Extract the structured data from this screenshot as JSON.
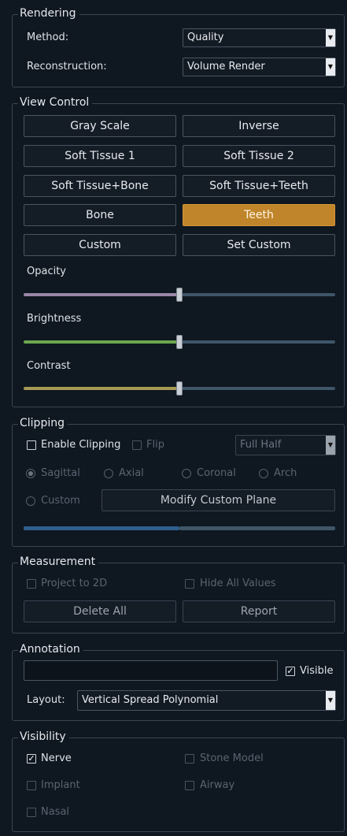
{
  "rendering": {
    "title": "Rendering",
    "method_label": "Method:",
    "method_value": "Quality",
    "reconstruction_label": "Reconstruction:",
    "reconstruction_value": "Volume Render"
  },
  "view_control": {
    "title": "View Control",
    "buttons": [
      "Gray Scale",
      "Inverse",
      "Soft Tissue 1",
      "Soft Tissue 2",
      "Soft Tissue+Bone",
      "Soft Tissue+Teeth",
      "Bone",
      "Teeth",
      "Custom",
      "Set Custom"
    ],
    "active_button": "Teeth",
    "opacity": {
      "label": "Opacity",
      "value": 0.5
    },
    "brightness": {
      "label": "Brightness",
      "value": 0.5
    },
    "contrast": {
      "label": "Contrast",
      "value": 0.5
    },
    "colors": {
      "opacity": "#9a86a8",
      "brightness": "#6aa84f",
      "contrast": "#a89a55",
      "rest": "#3e5668",
      "active": "#c0852a"
    }
  },
  "clipping": {
    "title": "Clipping",
    "enable_label": "Enable Clipping",
    "enable_checked": false,
    "flip_label": "Flip",
    "mode_value": "Full Half",
    "radios": [
      "Sagittal",
      "Axial",
      "Coronal",
      "Arch",
      "Custom"
    ],
    "selected_radio": "Sagittal",
    "modify_label": "Modify Custom Plane",
    "slider_value": 0.5
  },
  "measurement": {
    "title": "Measurement",
    "project_label": "Project to 2D",
    "hide_label": "Hide All Values",
    "delete_label": "Delete All",
    "report_label": "Report"
  },
  "annotation": {
    "title": "Annotation",
    "text_value": "",
    "visible_label": "Visible",
    "visible_checked": true,
    "layout_label": "Layout:",
    "layout_value": "Vertical Spread Polynomial"
  },
  "visibility": {
    "title": "Visibility",
    "nerve_label": "Nerve",
    "nerve_checked": true,
    "stone_label": "Stone Model",
    "implant_label": "Implant",
    "airway_label": "Airway",
    "nasal_label": "Nasal"
  }
}
